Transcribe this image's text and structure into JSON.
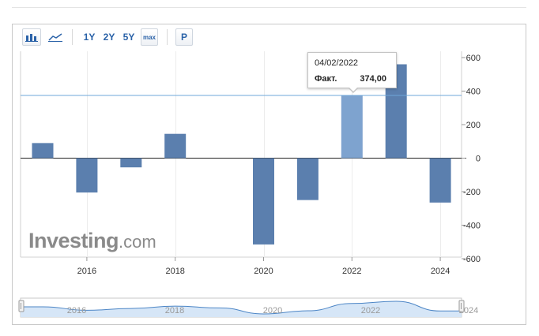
{
  "toolbar": {
    "bar_chart_icon": "bar-chart-icon",
    "line_chart_icon": "line-chart-icon",
    "range_1y": "1Y",
    "range_2y": "2Y",
    "range_5y": "5Y",
    "range_max": "max",
    "portfolio_button": "P"
  },
  "tooltip": {
    "date": "04/02/2022",
    "label": "Факт.",
    "value": "374,00"
  },
  "watermark": {
    "main": "Investing",
    "suffix": ".com"
  },
  "colors": {
    "bar": "#5b7fae",
    "bar_highlight": "#7ea3cf",
    "reference_line": "#6fa7d8",
    "navigator_fill": "#d6e6f7",
    "navigator_line": "#4d86c6"
  },
  "chart_data": {
    "type": "bar",
    "categories": [
      "2015",
      "2016",
      "2017",
      "2018",
      "2019",
      "2020",
      "2021",
      "2022",
      "2023",
      "2024"
    ],
    "values": [
      90,
      -205,
      -55,
      145,
      0,
      -515,
      -250,
      374,
      560,
      -265
    ],
    "highlight_index": 7,
    "reference_value": 374,
    "x_tick_labels": [
      "2016",
      "2018",
      "2020",
      "2022",
      "2024"
    ],
    "y_tick_labels": [
      "600",
      "400",
      "200",
      "0",
      "-200",
      "-400",
      "-600"
    ],
    "ylim": [
      -600,
      600
    ],
    "grid": "vertical",
    "navigator": {
      "tick_labels": [
        "2016",
        "2018",
        "2020",
        "2022",
        "2024"
      ],
      "values": [
        90,
        -205,
        -55,
        145,
        0,
        -515,
        -250,
        374,
        560,
        -265
      ]
    }
  }
}
